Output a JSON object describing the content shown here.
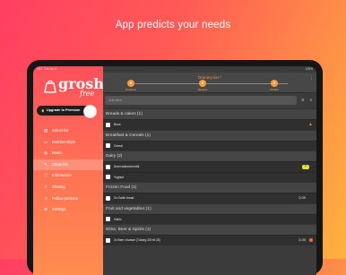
{
  "headline": "App predicts your needs",
  "status": {
    "time": "9:41",
    "date": "Tue Jan 9",
    "right": "100%"
  },
  "sidebar": {
    "logo_word": "grosh",
    "logo_sub": "free",
    "premium_label": "Upgrade to Premium",
    "nav": [
      {
        "label": "Select list",
        "icon": "list-icon"
      },
      {
        "label": "Memberships",
        "icon": "card-icon"
      },
      {
        "label": "Meals",
        "icon": "meal-icon"
      },
      {
        "label": "Clean list",
        "icon": "clean-icon"
      },
      {
        "label": "Information",
        "icon": "info-icon"
      },
      {
        "label": "Sharing",
        "icon": "share-icon"
      },
      {
        "label": "Follow persons",
        "icon": "follow-icon"
      },
      {
        "label": "Settings",
        "icon": "gear-icon"
      }
    ],
    "active_index": 3
  },
  "main": {
    "title": "Grocery list ^",
    "tabs": [
      {
        "label": "Products"
      },
      {
        "label": "Recipes"
      },
      {
        "label": "Predict"
      }
    ],
    "search_placeholder": "Add item",
    "categories": [
      {
        "name": "Breads & cakes (1)",
        "items": [
          {
            "name": "Buns",
            "warn": true
          }
        ]
      },
      {
        "name": "Breakfast & Cereals (1)",
        "items": [
          {
            "name": "Cereal"
          }
        ]
      },
      {
        "name": "Dairy (2)",
        "items": [
          {
            "name": "Semi skimmed milk",
            "badge": "1L"
          },
          {
            "name": "Yoghurt"
          }
        ]
      },
      {
        "name": "Frozen Food (1)",
        "items": [
          {
            "name": "2x Garlic bread",
            "price": "2,00"
          }
        ]
      },
      {
        "name": "Fruit and vegetables (1)",
        "items": [
          {
            "name": "Garlic"
          }
        ]
      },
      {
        "name": "Wine, Beer & Spirits (1)",
        "items": [
          {
            "name": "2x Beer chooser (Tuborg 33l ml 33)",
            "price": "2,00",
            "alert": true
          }
        ]
      }
    ]
  }
}
